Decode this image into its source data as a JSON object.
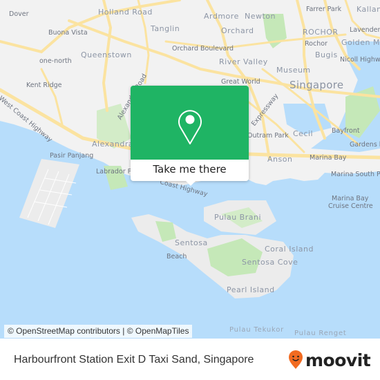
{
  "map": {
    "labels": {
      "dover": "Dover",
      "holland_road": "Holland Road",
      "buona_vista": "Buona Vista",
      "tanglin": "Tanglin",
      "ardmore": "Ardmore",
      "newton": "Newton",
      "farrer_park": "Farrer Park",
      "kallang": "Kallan",
      "queenstown": "Queenstown",
      "orchard": "Orchard",
      "rochor_district": "ROCHOR",
      "lavender": "Lavender",
      "rochor": "Rochor",
      "golden_mile": "Golden Mi",
      "one_north": "one-north",
      "orchard_boulevard": "Orchard Boulevard",
      "bugis": "Bugis",
      "river_valley": "River Valley",
      "nicoll_highway": "Nicoll Highway",
      "kent_ridge": "Kent Ridge",
      "alexandra_road": "Alexandra Road",
      "great_world": "Great World",
      "museum": "Museum",
      "singapore": "Singapore",
      "west_coast_highway": "West Coast Highway",
      "expressway": "Expressway",
      "outram_park": "Outram Park",
      "cecil": "Cecil",
      "bayfront": "Bayfront",
      "gardens_by": "Gardens by",
      "alexandra": "Alexandra",
      "pasir_panjang": "Pasir Panjang",
      "anson": "Anson",
      "marina_bay": "Marina Bay",
      "labrador_park": "Labrador Park",
      "coast_highway": "Coast Highway",
      "marina_south_pier": "Marina South Pier",
      "marina_bay_cruise_1": "Marina Bay",
      "marina_bay_cruise_2": "Cruise Centre",
      "pulau_brani": "Pulau Brani",
      "sentosa": "Sentosa",
      "coral_island": "Coral Island",
      "beach": "Beach",
      "sentosa_cove": "Sentosa Cove",
      "pearl_island": "Pearl Island",
      "pulau_tekukor": "Pulau Tekukor",
      "pulau_renget": "Pulau Renget"
    },
    "popup": {
      "icon": "map-pin-icon",
      "cta_label": "Take me there",
      "color": "#1fb464"
    },
    "attribution": "© OpenStreetMap contributors | © OpenMapTiles"
  },
  "footer": {
    "title": "Harbourfront Station Exit D Taxi Sand, Singapore",
    "logo_text": "moovit",
    "logo_icon": "moovit-smiley-pin-icon",
    "logo_accent": "#f26b21"
  }
}
